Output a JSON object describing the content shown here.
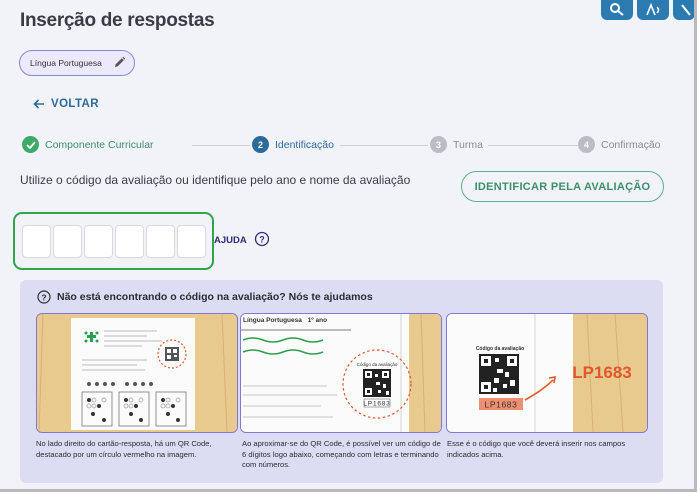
{
  "page_title": "Inserção de respostas",
  "subject_chip": "Língua Portuguesa",
  "back_label": "VOLTAR",
  "steps": [
    {
      "number": "",
      "label": "Componente Curricular",
      "status": "done"
    },
    {
      "number": "2",
      "label": "Identificação",
      "status": "active"
    },
    {
      "number": "3",
      "label": "Turma",
      "status": "pending"
    },
    {
      "number": "4",
      "label": "Confirmação",
      "status": "pending"
    }
  ],
  "instruction": "Utilize o código da avaliação ou identifique pelo ano e nome da avaliação",
  "identify_button": "IDENTIFICAR PELA AVALIAÇÃO",
  "code_inputs": [
    "",
    "",
    "",
    "",
    "",
    ""
  ],
  "help_link": "AJUDA",
  "help_box": {
    "title": "Não está encontrando o código na avaliação? Nós te ajudamos",
    "captions": [
      "No lado direito do cartão-resposta, há um QR Code, destacado por um círculo vermelho na imagem.",
      "Ao aproximar-se do QR Code, é possível ver um código de 6 dígitos logo abaixo, começando com letras e terminando com números.",
      "Esse é o código que você deverá inserir nos campos indicados acima."
    ],
    "panel2_heading": "Língua Portuguesa",
    "panel2_grade": "1º ano",
    "qr_label": "Código da avaliação",
    "example_code": "LP1683"
  },
  "colors": {
    "accent_blue": "#2c6a9c",
    "green": "#2da44e",
    "purple": "#8078d6",
    "orange": "#e2572b"
  }
}
